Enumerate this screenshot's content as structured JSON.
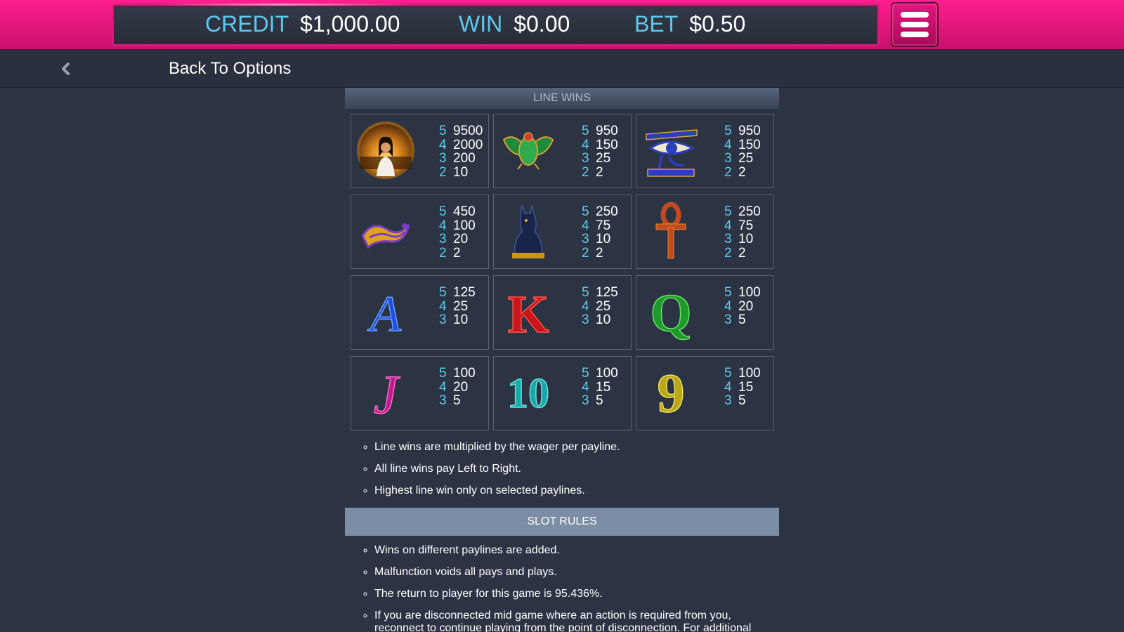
{
  "meters": {
    "credit": {
      "label": "CREDIT",
      "value": "$1,000.00"
    },
    "win": {
      "label": "WIN",
      "value": "$0.00"
    },
    "bet": {
      "label": "BET",
      "value": "$0.50"
    }
  },
  "icons": {
    "menu": "hamburger-menu-icon",
    "back": "chevron-left-icon"
  },
  "nav": {
    "back_label": "Back To Options"
  },
  "line_wins": {
    "title": "LINE WINS",
    "symbols": [
      {
        "icon": "cleopatra-symbol",
        "pays": [
          {
            "count": "5",
            "amount": "9500"
          },
          {
            "count": "4",
            "amount": "2000"
          },
          {
            "count": "3",
            "amount": "200"
          },
          {
            "count": "2",
            "amount": "10"
          }
        ]
      },
      {
        "icon": "scarab-symbol",
        "pays": [
          {
            "count": "5",
            "amount": "950"
          },
          {
            "count": "4",
            "amount": "150"
          },
          {
            "count": "3",
            "amount": "25"
          },
          {
            "count": "2",
            "amount": "2"
          }
        ]
      },
      {
        "icon": "eye-of-horus-symbol",
        "pays": [
          {
            "count": "5",
            "amount": "950"
          },
          {
            "count": "4",
            "amount": "150"
          },
          {
            "count": "3",
            "amount": "25"
          },
          {
            "count": "2",
            "amount": "2"
          }
        ]
      },
      {
        "icon": "serpent-symbol",
        "pays": [
          {
            "count": "5",
            "amount": "450"
          },
          {
            "count": "4",
            "amount": "100"
          },
          {
            "count": "3",
            "amount": "20"
          },
          {
            "count": "2",
            "amount": "2"
          }
        ]
      },
      {
        "icon": "cat-statue-symbol",
        "pays": [
          {
            "count": "5",
            "amount": "250"
          },
          {
            "count": "4",
            "amount": "75"
          },
          {
            "count": "3",
            "amount": "10"
          },
          {
            "count": "2",
            "amount": "2"
          }
        ]
      },
      {
        "icon": "ankh-symbol",
        "pays": [
          {
            "count": "5",
            "amount": "250"
          },
          {
            "count": "4",
            "amount": "75"
          },
          {
            "count": "3",
            "amount": "10"
          },
          {
            "count": "2",
            "amount": "2"
          }
        ]
      },
      {
        "icon": "ace-symbol",
        "pays": [
          {
            "count": "5",
            "amount": "125"
          },
          {
            "count": "4",
            "amount": "25"
          },
          {
            "count": "3",
            "amount": "10"
          }
        ]
      },
      {
        "icon": "king-symbol",
        "pays": [
          {
            "count": "5",
            "amount": "125"
          },
          {
            "count": "4",
            "amount": "25"
          },
          {
            "count": "3",
            "amount": "10"
          }
        ]
      },
      {
        "icon": "queen-symbol",
        "pays": [
          {
            "count": "5",
            "amount": "100"
          },
          {
            "count": "4",
            "amount": "20"
          },
          {
            "count": "3",
            "amount": "5"
          }
        ]
      },
      {
        "icon": "jack-symbol",
        "pays": [
          {
            "count": "5",
            "amount": "100"
          },
          {
            "count": "4",
            "amount": "20"
          },
          {
            "count": "3",
            "amount": "5"
          }
        ]
      },
      {
        "icon": "ten-symbol",
        "pays": [
          {
            "count": "5",
            "amount": "100"
          },
          {
            "count": "4",
            "amount": "15"
          },
          {
            "count": "3",
            "amount": "5"
          }
        ]
      },
      {
        "icon": "nine-symbol",
        "pays": [
          {
            "count": "5",
            "amount": "100"
          },
          {
            "count": "4",
            "amount": "15"
          },
          {
            "count": "3",
            "amount": "5"
          }
        ]
      }
    ],
    "notes": [
      "Line wins are multiplied by the wager per payline.",
      "All line wins pay Left to Right.",
      "Highest line win only on selected paylines."
    ]
  },
  "slot_rules": {
    "title": "SLOT RULES",
    "notes": [
      "Wins on different paylines are added.",
      "Malfunction voids all pays and plays.",
      "The return to player for this game is 95.436%.",
      "If you are disconnected mid game where an action is required from you, reconnect to continue playing from the point of disconnection. For additional"
    ]
  },
  "letter_glyphs": {
    "ace": "A",
    "king": "K",
    "queen": "Q",
    "jack": "J",
    "ten": "10",
    "nine": "9"
  },
  "colors": {
    "header_pink": "#e0177f",
    "accent_cyan": "#5fc8ee",
    "background": "#2c3443",
    "slot_rules_header": "#7b8ea6"
  }
}
